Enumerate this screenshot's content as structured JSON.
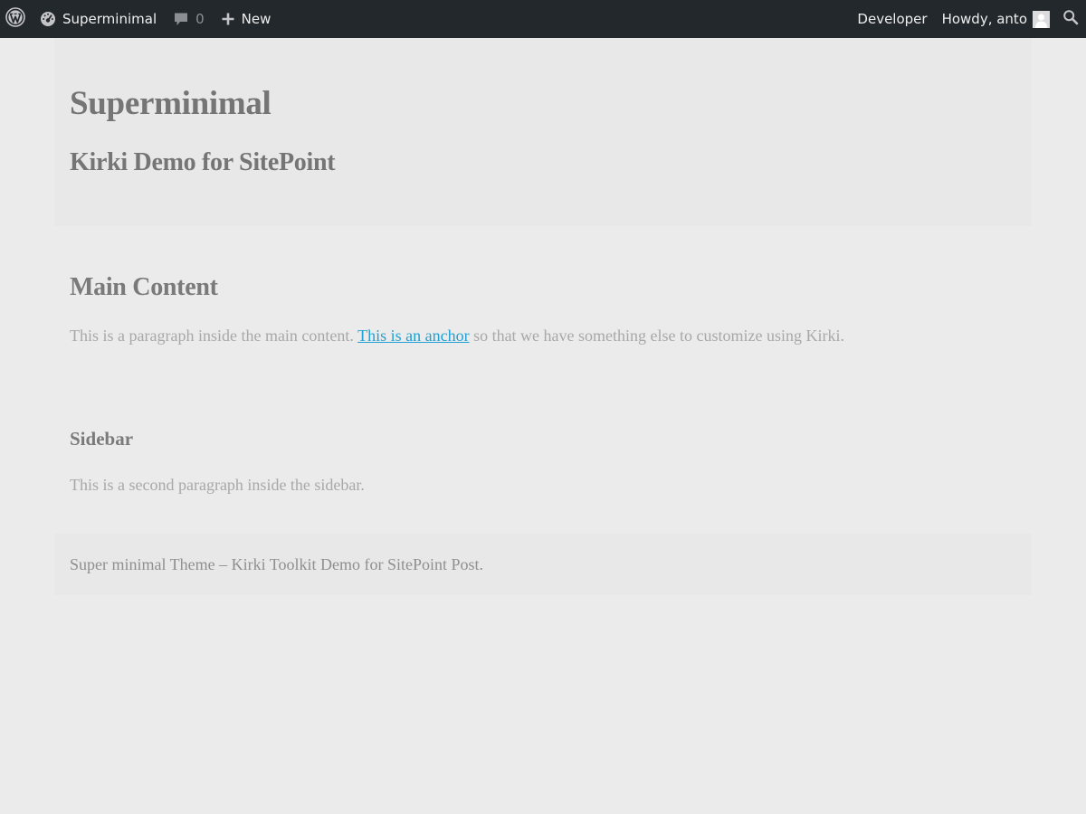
{
  "adminbar": {
    "wp_logo_icon": "wordpress-logo-icon",
    "site_icon": "dashboard-icon",
    "site_name": "Superminimal",
    "comments_icon": "comment-icon",
    "comments_count": "0",
    "new_icon": "plus-icon",
    "new_label": "New",
    "developer_label": "Developer",
    "howdy_label": "Howdy, anto",
    "avatar_icon": "user-avatar-icon",
    "search_icon": "search-icon",
    "background_color": "#23282d"
  },
  "header": {
    "site_title": "Superminimal",
    "tagline": "Kirki Demo for SitePoint"
  },
  "main": {
    "title": "Main Content",
    "paragraph_before": "This is a paragraph inside the main content. ",
    "anchor_text": "This is an anchor",
    "paragraph_after": " so that we have something else to customize using Kirki.",
    "link_color": "#21a0d6"
  },
  "sidebar": {
    "title": "Sidebar",
    "paragraph": "This is a second paragraph inside the sidebar."
  },
  "footer": {
    "text": "Super minimal Theme – Kirki Toolkit Demo for SitePoint Post."
  },
  "colors": {
    "page_background": "#ebebeb",
    "text_muted": "#a8a8a8",
    "heading": "#757575"
  }
}
